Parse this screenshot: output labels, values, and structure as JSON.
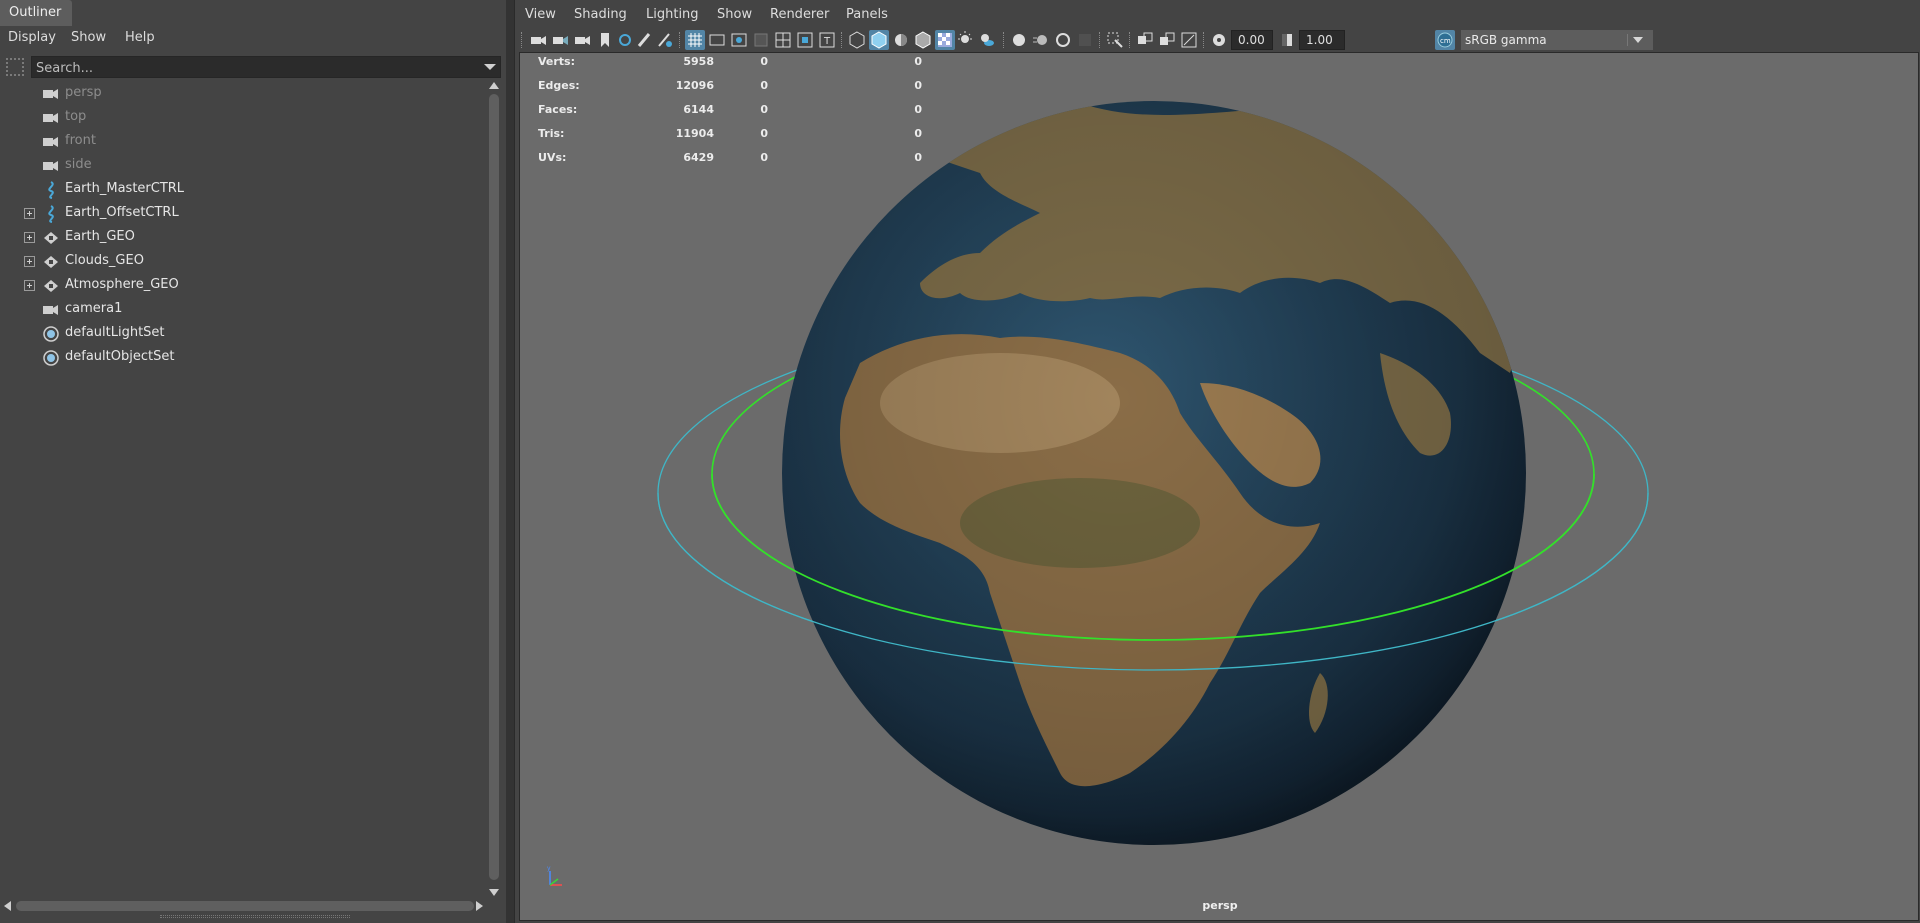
{
  "outliner": {
    "tab_title": "Outliner",
    "menus": [
      "Display",
      "Show",
      "Help"
    ],
    "search_placeholder": "Search...",
    "items": [
      {
        "label": "persp",
        "icon": "camera-icon",
        "dim": true,
        "expandable": false
      },
      {
        "label": "top",
        "icon": "camera-icon",
        "dim": true,
        "expandable": false
      },
      {
        "label": "front",
        "icon": "camera-icon",
        "dim": true,
        "expandable": false
      },
      {
        "label": "side",
        "icon": "camera-icon",
        "dim": true,
        "expandable": false
      },
      {
        "label": "Earth_MasterCTRL",
        "icon": "curve-icon",
        "dim": false,
        "expandable": false
      },
      {
        "label": "Earth_OffsetCTRL",
        "icon": "curve-icon",
        "dim": false,
        "expandable": true
      },
      {
        "label": "Earth_GEO",
        "icon": "mesh-icon",
        "dim": false,
        "expandable": true
      },
      {
        "label": "Clouds_GEO",
        "icon": "mesh-icon",
        "dim": false,
        "expandable": true
      },
      {
        "label": "Atmosphere_GEO",
        "icon": "mesh-icon",
        "dim": false,
        "expandable": true
      },
      {
        "label": "camera1",
        "icon": "camera-icon",
        "dim": false,
        "expandable": false
      },
      {
        "label": "defaultLightSet",
        "icon": "set-icon",
        "dim": false,
        "expandable": false
      },
      {
        "label": "defaultObjectSet",
        "icon": "set-icon",
        "dim": false,
        "expandable": false
      }
    ]
  },
  "viewport": {
    "menus": [
      "View",
      "Shading",
      "Lighting",
      "Show",
      "Renderer",
      "Panels"
    ],
    "exposure_value": "0.00",
    "gamma_value": "1.00",
    "color_space": "sRGB gamma",
    "camera_name": "persp",
    "hud": [
      {
        "label": "Verts:",
        "v1": "5958",
        "v2": "0",
        "v3": "0"
      },
      {
        "label": "Edges:",
        "v1": "12096",
        "v2": "0",
        "v3": "0"
      },
      {
        "label": "Faces:",
        "v1": "6144",
        "v2": "0",
        "v3": "0"
      },
      {
        "label": "Tris:",
        "v1": "11904",
        "v2": "0",
        "v3": "0"
      },
      {
        "label": "UVs:",
        "v1": "6429",
        "v2": "0",
        "v3": "0"
      }
    ],
    "colors": {
      "background": "#6b6b6b",
      "ring_outer": "#3fb6c6",
      "ring_inner": "#33e02a",
      "ocean": "#1d3a52",
      "land": "#8a6d47",
      "highlight": "#5285a6"
    }
  }
}
